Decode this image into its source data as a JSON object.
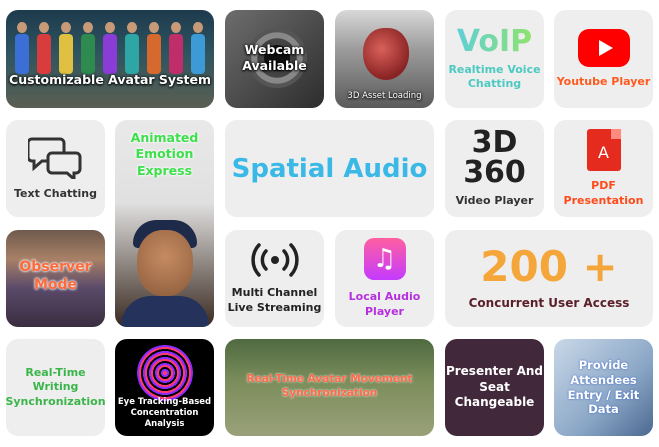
{
  "tiles": {
    "avatar": "Customizable Avatar System",
    "webcam": "Webcam Available",
    "asset": "3D Asset Loading",
    "voip_big": "VoIP",
    "voip_sub": "Realtime Voice Chatting",
    "youtube": "Youtube Player",
    "text_chat": "Text Chatting",
    "emotion": "Animated Emotion Express",
    "spatial": "Spatial Audio",
    "three_d": "3D",
    "three_sixty": "360",
    "video_player": "Video Player",
    "pdf_icon": "A",
    "pdf": "PDF Presentation",
    "observer": "Observer Mode",
    "multi_channel": "Multi Channel Live Streaming",
    "local_audio_icon": "♫",
    "local_audio": "Local Audio Player",
    "users_big": "200 +",
    "users_sub": "Concurrent User Access",
    "writing": "Real-Time Writing Synchronization",
    "eye": "Eye Tracking-Based Concentration Analysis",
    "movement": "Real-Time Avatar Movement Synchronization",
    "presenter": "Presenter And Seat Changeable",
    "attendees": "Provide Attendees Entry / Exit Data"
  },
  "colors": {
    "voip": "#4cc9c1",
    "youtube_red": "#ff0000",
    "spatial": "#3ab8e6",
    "users": "#f4a63a",
    "writing": "#3bb54a",
    "presenter_bg": "#41283a"
  }
}
